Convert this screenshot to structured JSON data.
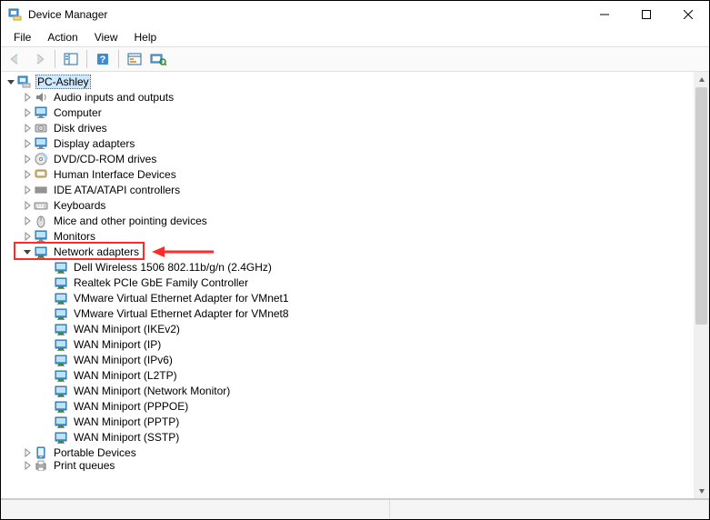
{
  "window": {
    "title": "Device Manager"
  },
  "menu": {
    "file": "File",
    "action": "Action",
    "view": "View",
    "help": "Help"
  },
  "tree": {
    "root": "PC-Ashley",
    "categories": [
      {
        "label": "Audio inputs and outputs",
        "icon": "speaker",
        "expanded": false
      },
      {
        "label": "Computer",
        "icon": "monitor",
        "expanded": false
      },
      {
        "label": "Disk drives",
        "icon": "disk",
        "expanded": false
      },
      {
        "label": "Display adapters",
        "icon": "monitor",
        "expanded": false
      },
      {
        "label": "DVD/CD-ROM drives",
        "icon": "disc",
        "expanded": false
      },
      {
        "label": "Human Interface Devices",
        "icon": "hid",
        "expanded": false
      },
      {
        "label": "IDE ATA/ATAPI controllers",
        "icon": "ide",
        "expanded": false
      },
      {
        "label": "Keyboards",
        "icon": "keyboard",
        "expanded": false
      },
      {
        "label": "Mice and other pointing devices",
        "icon": "mouse",
        "expanded": false
      },
      {
        "label": "Monitors",
        "icon": "monitor",
        "expanded": false
      },
      {
        "label": "Network adapters",
        "icon": "nic",
        "expanded": true,
        "highlighted": true,
        "children": [
          "Dell Wireless 1506 802.11b/g/n (2.4GHz)",
          "Realtek PCIe GbE Family Controller",
          "VMware Virtual Ethernet Adapter for VMnet1",
          "VMware Virtual Ethernet Adapter for VMnet8",
          "WAN Miniport (IKEv2)",
          "WAN Miniport (IP)",
          "WAN Miniport (IPv6)",
          "WAN Miniport (L2TP)",
          "WAN Miniport (Network Monitor)",
          "WAN Miniport (PPPOE)",
          "WAN Miniport (PPTP)",
          "WAN Miniport (SSTP)"
        ]
      },
      {
        "label": "Portable Devices",
        "icon": "portable",
        "expanded": false
      },
      {
        "label": "Print queues",
        "icon": "printer",
        "expanded": false,
        "cutoff": true
      }
    ]
  }
}
